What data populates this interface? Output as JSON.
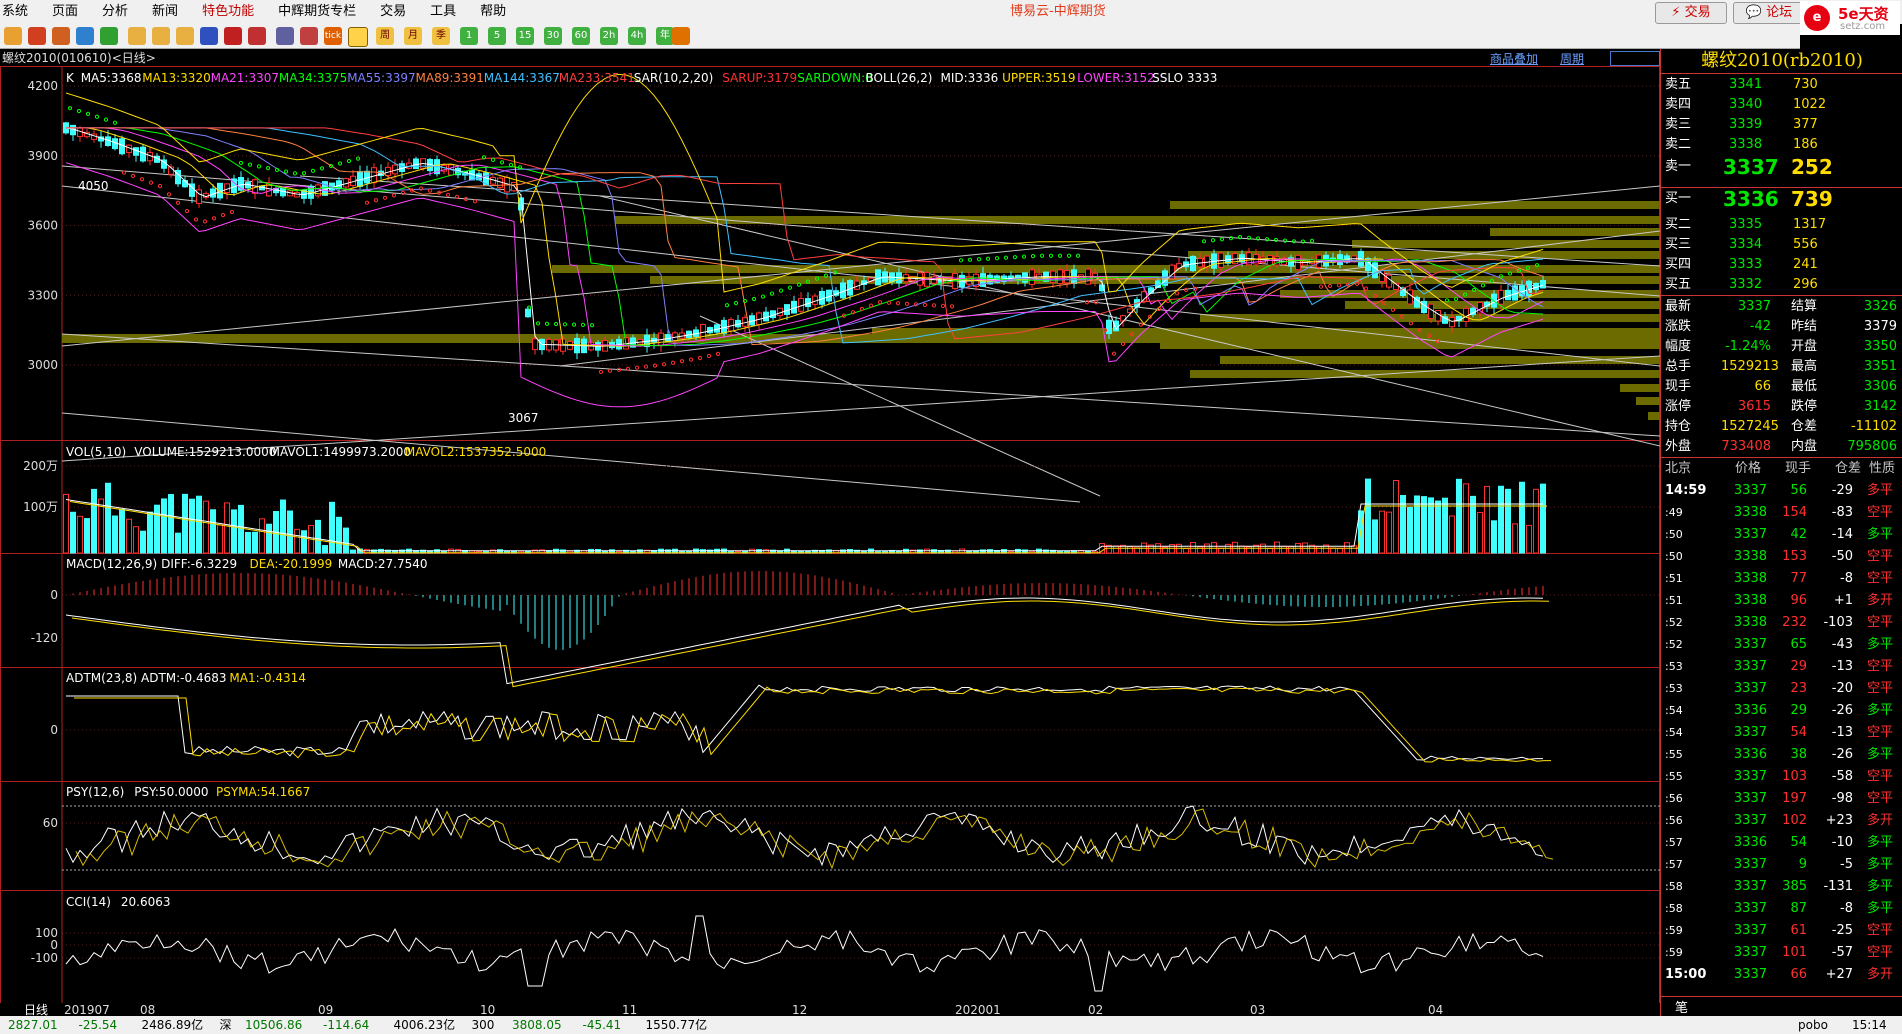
{
  "menu": [
    "系统",
    "页面",
    "分析",
    "新闻",
    "特色功能",
    "中辉期货专栏",
    "交易",
    "工具",
    "帮助"
  ],
  "app_title": "博易云-中辉期货",
  "trade_label": "交易",
  "forum_label": "论坛",
  "brand": {
    "name": "5e天资",
    "site": "setz.com",
    "logo_char": "e"
  },
  "chart_tab": "螺纹2010(010610)<日线>",
  "links": {
    "overlay": "商品叠加",
    "period": "周期"
  },
  "toolbar_keys": [
    "周",
    "月",
    "季",
    "1",
    "5",
    "15",
    "30",
    "60",
    "2h",
    "4h",
    "年"
  ],
  "main_indicator": [
    {
      "t": "K",
      "c": "#ffffff"
    },
    {
      "t": "MA5:3368",
      "c": "#ffffff"
    },
    {
      "t": "MA13:3320",
      "c": "#ffdd00"
    },
    {
      "t": "MA21:3307",
      "c": "#ff44ff"
    },
    {
      "t": "MA34:3375",
      "c": "#00ff00"
    },
    {
      "t": "MA55:3397",
      "c": "#8080ff"
    },
    {
      "t": "MA89:3391",
      "c": "#ff8040"
    },
    {
      "t": "MA144:3367",
      "c": "#40c0ff"
    },
    {
      "t": "MA233:3541",
      "c": "#ff4040"
    },
    {
      "t": "SAR(10,2,20)",
      "c": "#ffffff"
    },
    {
      "t": "SARUP:3179",
      "c": "#ff3030"
    },
    {
      "t": "SARDOWN:0",
      "c": "#00ff00"
    },
    {
      "t": "BOLL(26,2)",
      "c": "#ffffff"
    },
    {
      "t": "MID:3336",
      "c": "#ffffff"
    },
    {
      "t": "UPPER:3519",
      "c": "#ffdd00"
    },
    {
      "t": "LOWER:3152",
      "c": "#ff44ff"
    },
    {
      "t": "SSLO 3333",
      "c": "#ffffff"
    }
  ],
  "price_axis": [
    "4200",
    "3900",
    "3600",
    "3300",
    "3000"
  ],
  "high_label": "4050",
  "low_label": "3067",
  "vol_header": [
    {
      "t": "VOL(5,10)",
      "c": "#ffffff"
    },
    {
      "t": "VOLUME:1529213.0000",
      "c": "#ffffff"
    },
    {
      "t": "MAVOL1:1499973.2000",
      "c": "#ffffff"
    },
    {
      "t": "MAVOL2:1537352.5000",
      "c": "#ffdd00"
    }
  ],
  "vol_axis": [
    "200万",
    "100万"
  ],
  "macd_header": [
    {
      "t": "MACD(12,26,9)",
      "c": "#ffffff"
    },
    {
      "t": "DIFF:-6.3229",
      "c": "#ffffff"
    },
    {
      "t": "DEA:-20.1999",
      "c": "#ffdd00"
    },
    {
      "t": "MACD:27.7540",
      "c": "#ffffff"
    }
  ],
  "macd_axis": [
    "0",
    "-120"
  ],
  "adtm_header": [
    {
      "t": "ADTM(23,8)",
      "c": "#ffffff"
    },
    {
      "t": "ADTM:-0.4683",
      "c": "#ffffff"
    },
    {
      "t": "MA1:-0.4314",
      "c": "#ffdd00"
    }
  ],
  "adtm_axis": [
    "0"
  ],
  "psy_header": [
    {
      "t": "PSY(12,6)",
      "c": "#ffffff"
    },
    {
      "t": "PSY:50.0000",
      "c": "#ffffff"
    },
    {
      "t": "PSYMA:54.1667",
      "c": "#ffdd00"
    }
  ],
  "psy_axis": [
    "60"
  ],
  "cci_header": [
    {
      "t": "CCI(14)",
      "c": "#ffffff"
    },
    {
      "t": "20.6063",
      "c": "#ffffff"
    }
  ],
  "cci_axis": [
    "100",
    "0",
    "-100"
  ],
  "period_label": "日线",
  "date_axis": [
    "201907",
    "08",
    "09",
    "10",
    "11",
    "12",
    "202001",
    "02",
    "03",
    "04"
  ],
  "quote": {
    "title": "螺纹2010(rb2010)",
    "asks": [
      {
        "label": "卖五",
        "price": "3341",
        "vol": "730"
      },
      {
        "label": "卖四",
        "price": "3340",
        "vol": "1022"
      },
      {
        "label": "卖三",
        "price": "3339",
        "vol": "377"
      },
      {
        "label": "卖二",
        "price": "3338",
        "vol": "186"
      }
    ],
    "ask1": {
      "label": "卖一",
      "price": "3337",
      "vol": "252"
    },
    "bid1": {
      "label": "买一",
      "price": "3336",
      "vol": "739"
    },
    "bids": [
      {
        "label": "买二",
        "price": "3335",
        "vol": "1317"
      },
      {
        "label": "买三",
        "price": "3334",
        "vol": "556"
      },
      {
        "label": "买四",
        "price": "3333",
        "vol": "241"
      },
      {
        "label": "买五",
        "price": "3332",
        "vol": "296"
      }
    ],
    "stats": [
      {
        "l1": "最新",
        "v1": "3337",
        "c1": "grn",
        "l2": "结算",
        "v2": "3326",
        "c2": "grn"
      },
      {
        "l1": "涨跌",
        "v1": "-42",
        "c1": "grn",
        "l2": "昨结",
        "v2": "3379",
        "c2": "wht"
      },
      {
        "l1": "幅度",
        "v1": "-1.24%",
        "c1": "grn",
        "l2": "开盘",
        "v2": "3350",
        "c2": "grn"
      },
      {
        "l1": "总手",
        "v1": "1529213",
        "c1": "yel",
        "l2": "最高",
        "v2": "3351",
        "c2": "grn"
      },
      {
        "l1": "现手",
        "v1": "66",
        "c1": "yel",
        "l2": "最低",
        "v2": "3306",
        "c2": "grn"
      },
      {
        "l1": "涨停",
        "v1": "3615",
        "c1": "red",
        "l2": "跌停",
        "v2": "3142",
        "c2": "grn"
      },
      {
        "l1": "持仓",
        "v1": "1527245",
        "c1": "yel",
        "l2": "仓差",
        "v2": "-11102",
        "c2": "yel"
      },
      {
        "l1": "外盘",
        "v1": "733408",
        "c1": "red",
        "l2": "内盘",
        "v2": "795806",
        "c2": "grn"
      }
    ],
    "ticks_header": [
      "北京",
      "价格",
      "现手",
      "仓差",
      "性质"
    ],
    "ticks": [
      {
        "t": "14:59",
        "p": "3337",
        "v": "56",
        "d": "-29",
        "n": "多平",
        "nc": "red",
        "big": true
      },
      {
        "t": ":49",
        "p": "3338",
        "v": "154",
        "d": "-83",
        "n": "空平",
        "nc": "red",
        "vc": "red"
      },
      {
        "t": ":50",
        "p": "3337",
        "v": "42",
        "d": "-14",
        "n": "多平",
        "nc": "grn"
      },
      {
        "t": ":50",
        "p": "3338",
        "v": "153",
        "d": "-50",
        "n": "空平",
        "nc": "red",
        "vc": "red"
      },
      {
        "t": ":51",
        "p": "3338",
        "v": "77",
        "d": "-8",
        "n": "空平",
        "nc": "red",
        "vc": "red"
      },
      {
        "t": ":51",
        "p": "3338",
        "v": "96",
        "d": "+1",
        "n": "多开",
        "nc": "red",
        "vc": "red"
      },
      {
        "t": ":52",
        "p": "3338",
        "v": "232",
        "d": "-103",
        "n": "空平",
        "nc": "red",
        "vc": "red"
      },
      {
        "t": ":52",
        "p": "3337",
        "v": "65",
        "d": "-43",
        "n": "多平",
        "nc": "grn"
      },
      {
        "t": ":53",
        "p": "3337",
        "v": "29",
        "d": "-13",
        "n": "空平",
        "nc": "red",
        "vc": "red"
      },
      {
        "t": ":53",
        "p": "3337",
        "v": "23",
        "d": "-20",
        "n": "空平",
        "nc": "red",
        "vc": "red"
      },
      {
        "t": ":54",
        "p": "3336",
        "v": "29",
        "d": "-26",
        "n": "多平",
        "nc": "grn"
      },
      {
        "t": ":54",
        "p": "3337",
        "v": "54",
        "d": "-13",
        "n": "空平",
        "nc": "red",
        "vc": "red"
      },
      {
        "t": ":55",
        "p": "3336",
        "v": "38",
        "d": "-26",
        "n": "多平",
        "nc": "grn"
      },
      {
        "t": ":55",
        "p": "3337",
        "v": "103",
        "d": "-58",
        "n": "空平",
        "nc": "red",
        "vc": "red"
      },
      {
        "t": ":56",
        "p": "3337",
        "v": "197",
        "d": "-98",
        "n": "空平",
        "nc": "red",
        "vc": "red"
      },
      {
        "t": ":56",
        "p": "3337",
        "v": "102",
        "d": "+23",
        "n": "多开",
        "nc": "red",
        "vc": "red"
      },
      {
        "t": ":57",
        "p": "3336",
        "v": "54",
        "d": "-10",
        "n": "多平",
        "nc": "grn"
      },
      {
        "t": ":57",
        "p": "3337",
        "v": "9",
        "d": "-5",
        "n": "多平",
        "nc": "grn"
      },
      {
        "t": ":58",
        "p": "3337",
        "v": "385",
        "d": "-131",
        "n": "多平",
        "nc": "grn"
      },
      {
        "t": ":58",
        "p": "3337",
        "v": "87",
        "d": "-8",
        "n": "多平",
        "nc": "grn"
      },
      {
        "t": ":59",
        "p": "3337",
        "v": "61",
        "d": "-25",
        "n": "空平",
        "nc": "red",
        "vc": "red"
      },
      {
        "t": ":59",
        "p": "3337",
        "v": "101",
        "d": "-57",
        "n": "空平",
        "nc": "red",
        "vc": "red"
      },
      {
        "t": "15:00",
        "p": "3337",
        "v": "66",
        "d": "+27",
        "n": "多开",
        "nc": "red",
        "vc": "red",
        "big": true
      }
    ],
    "bottom_tab": "笔"
  },
  "status": [
    {
      "t": "2827.01",
      "c": "#007700"
    },
    {
      "t": "-25.54",
      "c": "#007700"
    },
    {
      "t": "2486.89亿",
      "c": "#000"
    },
    {
      "t": "深",
      "c": "#000"
    },
    {
      "t": "10506.86",
      "c": "#007700"
    },
    {
      "t": "-114.64",
      "c": "#007700"
    },
    {
      "t": "4006.23亿",
      "c": "#000"
    },
    {
      "t": "300",
      "c": "#000"
    },
    {
      "t": "3808.05",
      "c": "#007700"
    },
    {
      "t": "-45.41",
      "c": "#007700"
    },
    {
      "t": "1550.77亿",
      "c": "#000"
    }
  ],
  "status_right": [
    "pobo",
    "15:14"
  ]
}
